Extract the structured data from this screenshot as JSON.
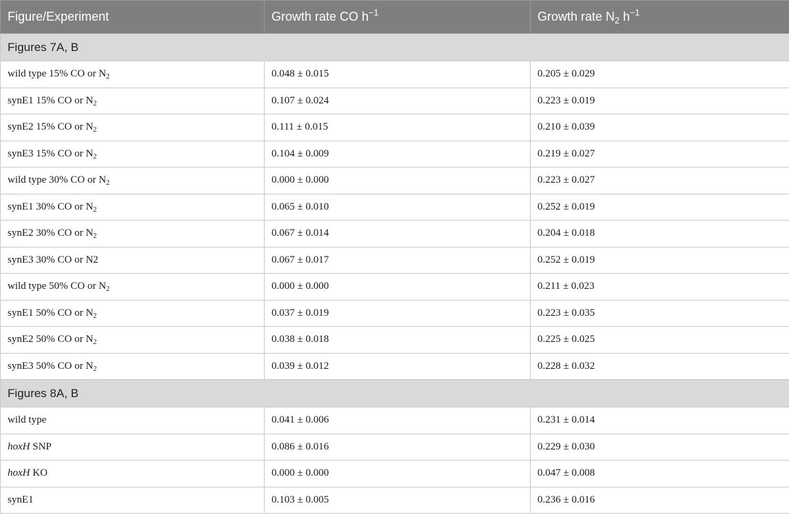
{
  "header": {
    "col1": "Figure/Experiment",
    "col2_text": "Growth rate CO h",
    "col2_sup": "−1",
    "col3_text_a": "Growth rate N",
    "col3_sub": "2",
    "col3_text_b": " h",
    "col3_sup": "−1"
  },
  "sections": [
    {
      "title": "Figures 7A, B",
      "rows": [
        {
          "label": "wild type 15% CO or N",
          "sub": "2",
          "co": "0.048 ± 0.015",
          "n2": "0.205 ± 0.029"
        },
        {
          "label": "synE1 15% CO or N",
          "sub": "2",
          "co": "0.107 ± 0.024",
          "n2": "0.223 ± 0.019"
        },
        {
          "label": "synE2 15% CO or N",
          "sub": "2",
          "co": "0.111 ± 0.015",
          "n2": "0.210 ± 0.039"
        },
        {
          "label": "synE3 15% CO or N",
          "sub": "2",
          "co": "0.104 ± 0.009",
          "n2": "0.219 ± 0.027"
        },
        {
          "label": "wild type 30% CO or N",
          "sub": "2",
          "co": "0.000 ± 0.000",
          "n2": "0.223 ± 0.027"
        },
        {
          "label": "synE1 30% CO or N",
          "sub": "2",
          "co": "0.065 ± 0.010",
          "n2": "0.252 ± 0.019"
        },
        {
          "label": "synE2 30% CO or N",
          "sub": "2",
          "co": "0.067 ± 0.014",
          "n2": "0.204 ± 0.018"
        },
        {
          "label": "synE3 30% CO or N2",
          "sub": "",
          "co": "0.067 ± 0.017",
          "n2": "0.252 ± 0.019"
        },
        {
          "label": "wild type 50% CO or N",
          "sub": "2",
          "co": "0.000 ± 0.000",
          "n2": "0.211 ± 0.023"
        },
        {
          "label": "synE1 50% CO or N",
          "sub": "2",
          "co": "0.037 ± 0.019",
          "n2": "0.223 ± 0.035"
        },
        {
          "label": "synE2 50% CO or N",
          "sub": "2",
          "co": "0.038 ± 0.018",
          "n2": "0.225 ± 0.025"
        },
        {
          "label": "synE3 50% CO or N",
          "sub": "2",
          "co": "0.039 ± 0.012",
          "n2": "0.228 ± 0.032"
        }
      ]
    },
    {
      "title": "Figures 8A, B",
      "rows": [
        {
          "label": "wild type",
          "italic": "",
          "rest": "",
          "co": "0.041 ± 0.006",
          "n2": "0.231 ± 0.014"
        },
        {
          "label": "",
          "italic": "hoxH",
          "rest": " SNP",
          "co": "0.086 ± 0.016",
          "n2": "0.229 ± 0.030"
        },
        {
          "label": "",
          "italic": "hoxH",
          "rest": " KO",
          "co": "0.000 ± 0.000",
          "n2": "0.047 ± 0.008"
        },
        {
          "label": "synE1",
          "italic": "",
          "rest": "",
          "co": "0.103 ± 0.005",
          "n2": "0.236 ± 0.016"
        }
      ]
    }
  ]
}
